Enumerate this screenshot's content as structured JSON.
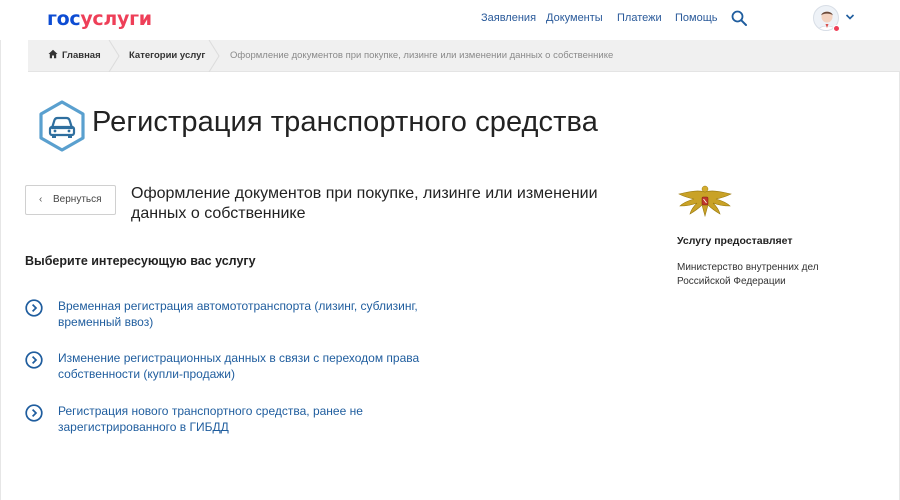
{
  "header": {
    "logo_part1": "гос",
    "logo_part2": "услуги",
    "nav": [
      {
        "label": "Заявления"
      },
      {
        "label": "Документы"
      },
      {
        "label": "Платежи"
      },
      {
        "label": "Помощь"
      }
    ]
  },
  "breadcrumbs": {
    "home": "Главная",
    "category": "Категории услуг",
    "current": "Оформление документов при покупке, лизинге или изменении данных о собственнике"
  },
  "page": {
    "title": "Регистрация транспортного средства",
    "back_label": "Вернуться",
    "back_arrow": "‹",
    "service_title": "Оформление документов при покупке, лизинге или изменении данных о собственнике",
    "section_heading": "Выберите интересующую вас услугу",
    "options": [
      {
        "label": "Временная регистрация автомототранспорта (лизинг, сублизинг, временный ввоз)"
      },
      {
        "label": "Изменение регистрационных данных в связи с переходом права собственности (купли-продажи)"
      },
      {
        "label": "Регистрация нового транспортного средства, ранее не зарегистрированного в ГИБДД"
      }
    ]
  },
  "provider": {
    "label": "Услугу предоставляет",
    "name": "Министерство внутренних дел Российской Федерации"
  },
  "icons": {
    "title": "car-icon",
    "search": "search-icon",
    "home": "home-icon",
    "option": "chevron-circle-icon",
    "emblem": "coat-of-arms-icon"
  },
  "colors": {
    "logo_blue": "#0d4cd3",
    "logo_red": "#ee3f58",
    "link": "#1f5d9e",
    "title_icon": "#5aa0cf"
  }
}
